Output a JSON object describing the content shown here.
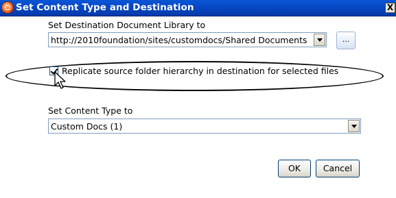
{
  "window": {
    "title": "Set Content Type and Destination",
    "close_label": "X"
  },
  "destination": {
    "label": "Set Destination Document Library to",
    "value": "http://2010foundation/sites/customdocs/Shared Documents",
    "browse_label": "..."
  },
  "replicate": {
    "checked": true,
    "label": "Replicate source folder hierarchy in destination for selected files"
  },
  "content_type": {
    "label": "Set Content Type to",
    "value": "Custom Docs (1)"
  },
  "buttons": {
    "ok": "OK",
    "cancel": "Cancel"
  }
}
